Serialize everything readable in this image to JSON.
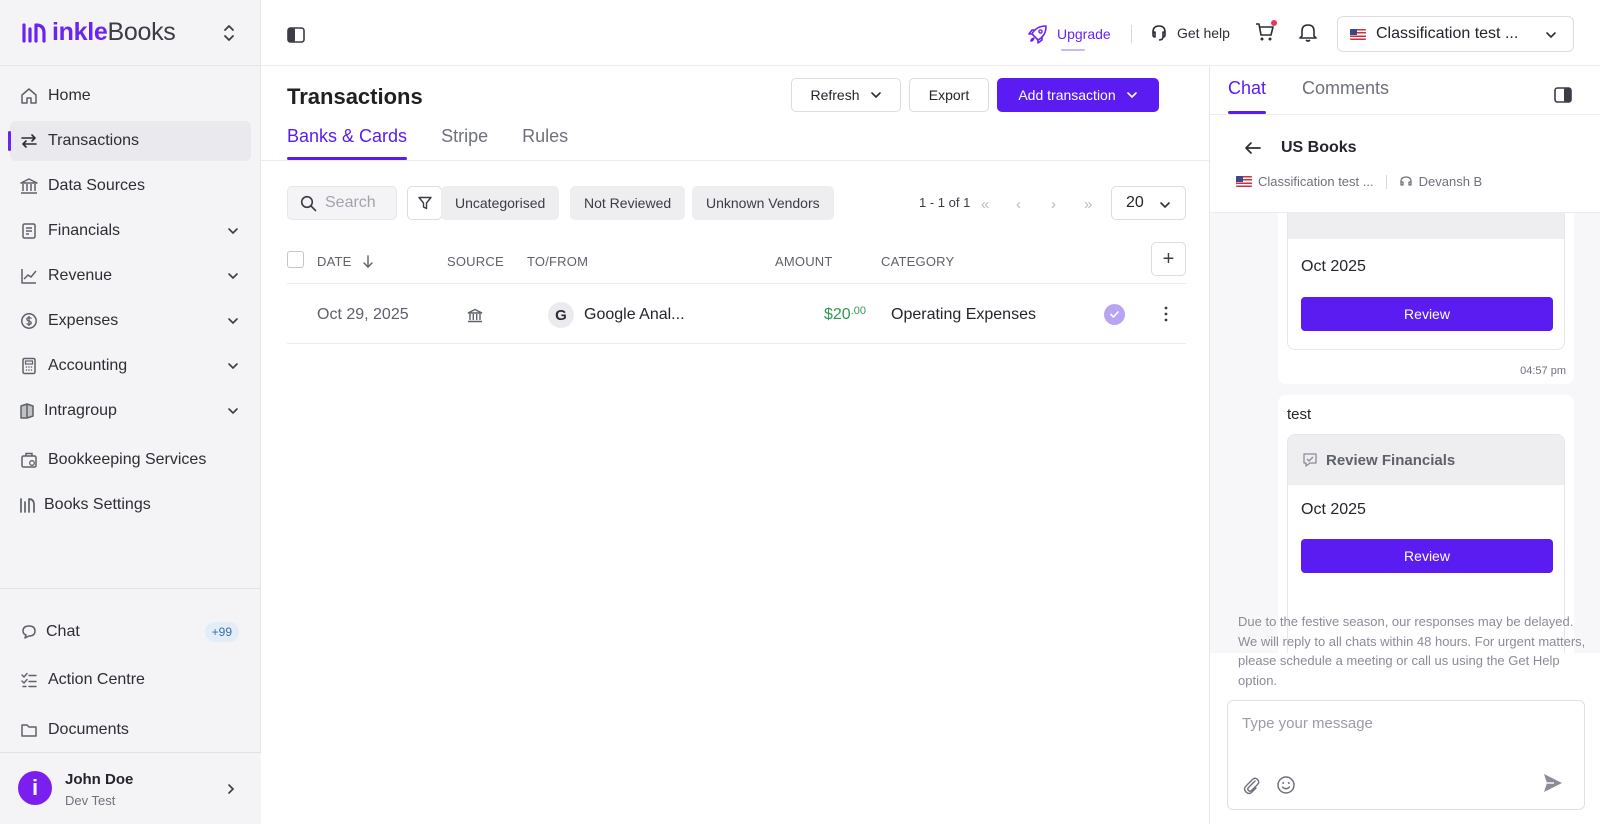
{
  "brand": {
    "name_prefix": "inkle",
    "name_suffix": "Books"
  },
  "sidebar": {
    "items": [
      {
        "label": "Home",
        "icon": "home-icon"
      },
      {
        "label": "Transactions",
        "icon": "arrows-exchange-icon",
        "active": true
      },
      {
        "label": "Data Sources",
        "icon": "bank-icon"
      },
      {
        "label": "Financials",
        "icon": "report-icon",
        "expandable": true
      },
      {
        "label": "Revenue",
        "icon": "trend-chart-icon",
        "expandable": true
      },
      {
        "label": "Expenses",
        "icon": "dollar-circle-icon",
        "expandable": true
      },
      {
        "label": "Accounting",
        "icon": "calculator-icon",
        "expandable": true
      },
      {
        "label": "Intragroup",
        "icon": "book-icon",
        "expandable": true
      },
      {
        "label": "Bookkeeping Services",
        "icon": "services-icon"
      },
      {
        "label": "Books Settings",
        "icon": "settings-chart-icon"
      }
    ],
    "bottom_items": [
      {
        "label": "Chat",
        "icon": "chat-icon",
        "badge": "+99"
      },
      {
        "label": "Action Centre",
        "icon": "checklist-icon"
      },
      {
        "label": "Documents",
        "icon": "folder-icon"
      }
    ],
    "profile": {
      "initial": "i",
      "name": "John Doe",
      "subtitle": "Dev Test"
    }
  },
  "topbar": {
    "upgrade_label": "Upgrade",
    "help_label": "Get help",
    "entity_name": "Classification test ..."
  },
  "main": {
    "title": "Transactions",
    "actions": {
      "refresh": "Refresh",
      "export": "Export",
      "add": "Add transaction"
    },
    "tabs": [
      {
        "label": "Banks & Cards",
        "active": true
      },
      {
        "label": "Stripe"
      },
      {
        "label": "Rules"
      }
    ],
    "search_placeholder": "Search",
    "filter_chips": [
      "Uncategorised",
      "Not Reviewed",
      "Unknown Vendors"
    ],
    "pagination": {
      "info": "1 - 1 of 1",
      "page_size": "20"
    },
    "columns": {
      "date": "DATE",
      "source": "SOURCE",
      "to_from": "TO/FROM",
      "amount": "AMOUNT",
      "category": "CATEGORY"
    },
    "rows": [
      {
        "date": "Oct 29, 2025",
        "source_icon": "bank-icon",
        "vendor_initial": "G",
        "vendor": "Google Anal...",
        "amount_main": "$20",
        "amount_cents": ".00",
        "category": "Operating Expenses",
        "reviewed": true
      }
    ]
  },
  "right_panel": {
    "tabs": [
      {
        "label": "Chat",
        "active": true
      },
      {
        "label": "Comments"
      }
    ],
    "chat_title": "US Books",
    "entity": "Classification test ...",
    "agent": "Devansh B",
    "messages": [
      {
        "month": "Oct 2025",
        "button": "Review",
        "time": "04:57 pm"
      },
      {
        "text": "test",
        "card_title": "Review Financials",
        "month": "Oct 2025",
        "button": "Review"
      }
    ],
    "notice": "Due to the festive season, our responses may be delayed. We will reply to all chats within 48 hours. For urgent matters, please schedule a meeting or call us using the Get Help option.",
    "composer_placeholder": "Type your message"
  },
  "colors": {
    "accent": "#5a1cf0",
    "brand": "#6a24f2",
    "positive": "#2f9a52"
  }
}
